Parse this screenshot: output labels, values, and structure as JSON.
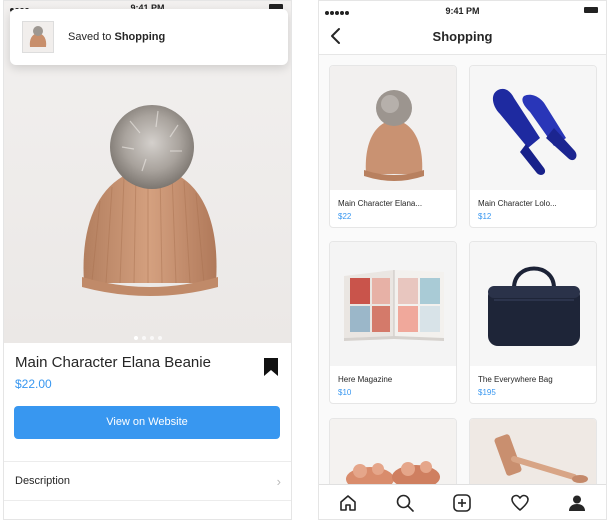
{
  "left_screen": {
    "status_time": "9:41 PM",
    "toast": {
      "prefix": "Saved to",
      "collection": "Shopping"
    },
    "product": {
      "name": "Main Character Elana Beanie",
      "price": "$22.00"
    },
    "cta_label": "View on Website",
    "description_label": "Description",
    "carousel": {
      "pages": 4,
      "active": 1
    }
  },
  "right_screen": {
    "status_time": "9:41 PM",
    "title": "Shopping",
    "items": [
      {
        "name": "Main Character Elana...",
        "price": "$22"
      },
      {
        "name": "Main Character Lolo...",
        "price": "$12"
      },
      {
        "name": "Here Magazine",
        "price": "$10"
      },
      {
        "name": "The Everywhere Bag",
        "price": "$195"
      }
    ],
    "tabs": [
      "home-icon",
      "search-icon",
      "add-icon",
      "heart-icon",
      "profile-icon"
    ]
  },
  "colors": {
    "link_blue": "#3897f0",
    "text": "#262626"
  }
}
